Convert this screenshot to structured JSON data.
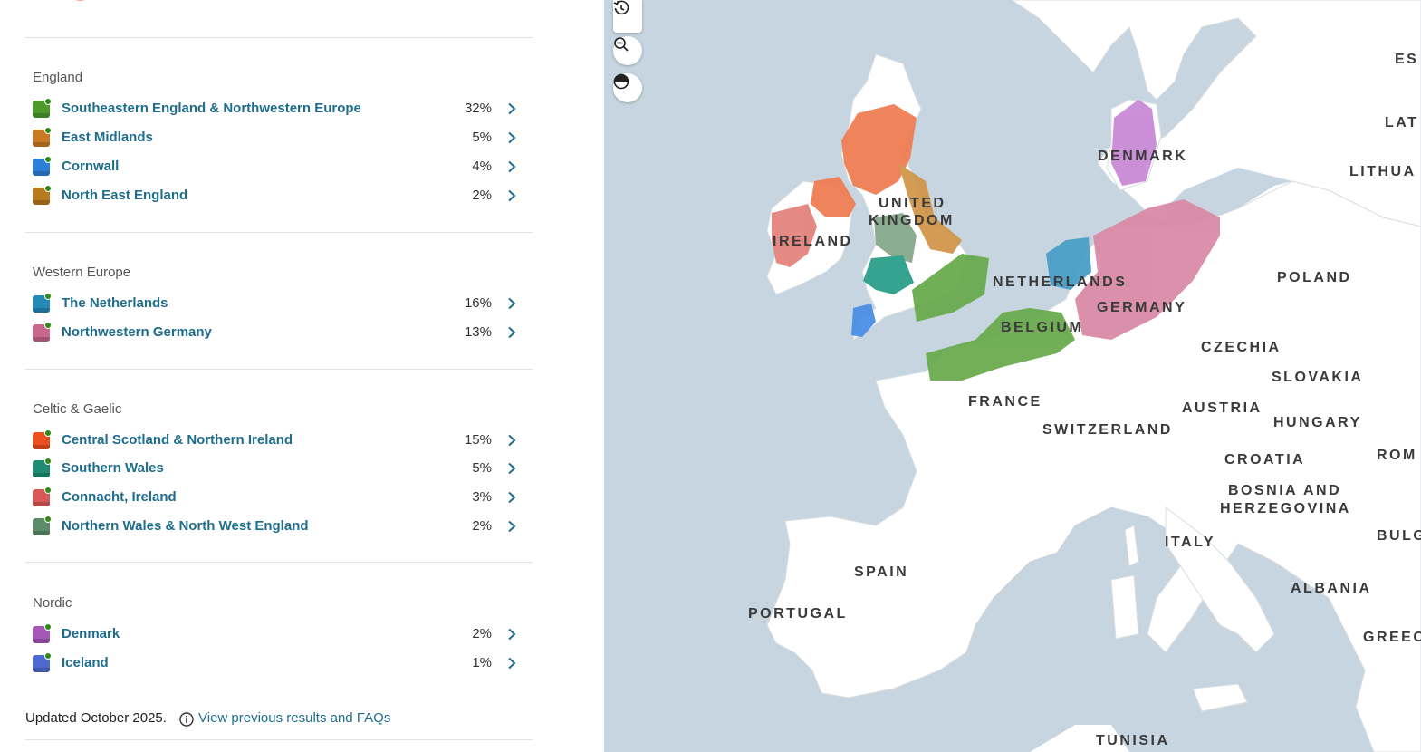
{
  "groups": [
    {
      "title": "England",
      "regions": [
        {
          "name": "Southeastern England & Northwestern Europe",
          "pct": "32%",
          "color": "#4d9a2a"
        },
        {
          "name": "East Midlands",
          "pct": "5%",
          "color": "#c77a23"
        },
        {
          "name": "Cornwall",
          "pct": "4%",
          "color": "#2c7fd8"
        },
        {
          "name": "North East England",
          "pct": "2%",
          "color": "#b87a1e"
        }
      ]
    },
    {
      "title": "Western Europe",
      "regions": [
        {
          "name": "The Netherlands",
          "pct": "16%",
          "color": "#2389b6"
        },
        {
          "name": "Northwestern Germany",
          "pct": "13%",
          "color": "#c9678c"
        }
      ]
    },
    {
      "title": "Celtic & Gaelic",
      "regions": [
        {
          "name": "Central Scotland & Northern Ireland",
          "pct": "15%",
          "color": "#e8501f"
        },
        {
          "name": "Southern Wales",
          "pct": "5%",
          "color": "#1f8b73"
        },
        {
          "name": "Connacht, Ireland",
          "pct": "3%",
          "color": "#d85858"
        },
        {
          "name": "Northern Wales & North West England",
          "pct": "2%",
          "color": "#5e8c6a"
        }
      ]
    },
    {
      "title": "Nordic",
      "regions": [
        {
          "name": "Denmark",
          "pct": "2%",
          "color": "#a658b8"
        },
        {
          "name": "Iceland",
          "pct": "1%",
          "color": "#4e69d0"
        }
      ]
    }
  ],
  "footer": {
    "updated": "Updated October 2025.",
    "link": "View previous results and FAQs"
  },
  "map": {
    "labels": [
      "DENMARK",
      "UNITED",
      "KINGDOM",
      "IRELAND",
      "NETHERLANDS",
      "GERMANY",
      "BELGIUM",
      "POLAND",
      "CZECHIA",
      "SLOVAKIA",
      "AUSTRIA",
      "HUNGARY",
      "FRANCE",
      "SWITZERLAND",
      "CROATIA",
      "BOSNIA AND",
      "HERZEGOVINA",
      "ITALY",
      "SPAIN",
      "PORTUGAL",
      "ALBANIA",
      "TUNISIA",
      "ES",
      "LAT",
      "LITHUA",
      "ROM",
      "BULG",
      "GREEC"
    ],
    "controls": [
      "reset-view",
      "zoom-out",
      "contrast"
    ]
  }
}
